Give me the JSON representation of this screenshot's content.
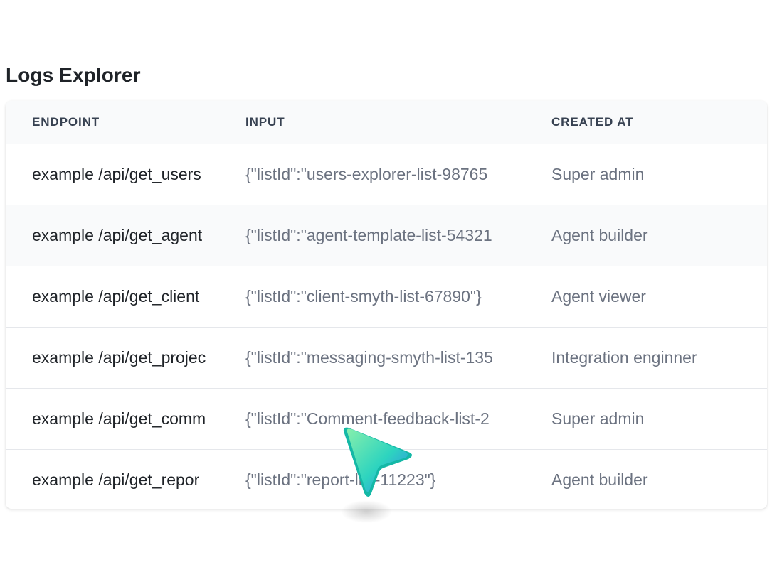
{
  "title": "Logs Explorer",
  "table": {
    "headers": {
      "endpoint": "ENDPOINT",
      "input": "INPUT",
      "created_at": "CREATED AT"
    },
    "rows": [
      {
        "endpoint": "example /api/get_users",
        "input": "{\"listId\":\"users-explorer-list-98765",
        "created_at": "Super admin"
      },
      {
        "endpoint": "example /api/get_agent",
        "input": "{\"listId\":\"agent-template-list-54321",
        "created_at": "Agent builder"
      },
      {
        "endpoint": "example /api/get_client",
        "input": "{\"listId\":\"client-smyth-list-67890\"}",
        "created_at": "Agent viewer"
      },
      {
        "endpoint": "example /api/get_projec",
        "input": "{\"listId\":\"messaging-smyth-list-135",
        "created_at": "Integration enginner"
      },
      {
        "endpoint": "example /api/get_comm",
        "input": "{\"listId\":\"Comment-feedback-list-2",
        "created_at": "Super admin"
      },
      {
        "endpoint": "example /api/get_repor",
        "input": "{\"listId\":\"report-list-11223\"}",
        "created_at": "Agent builder"
      }
    ]
  },
  "cursor": {
    "icon": "pointer-arrow-icon",
    "color_light": "#6ee7b7",
    "color_dark": "#14b8a6"
  }
}
